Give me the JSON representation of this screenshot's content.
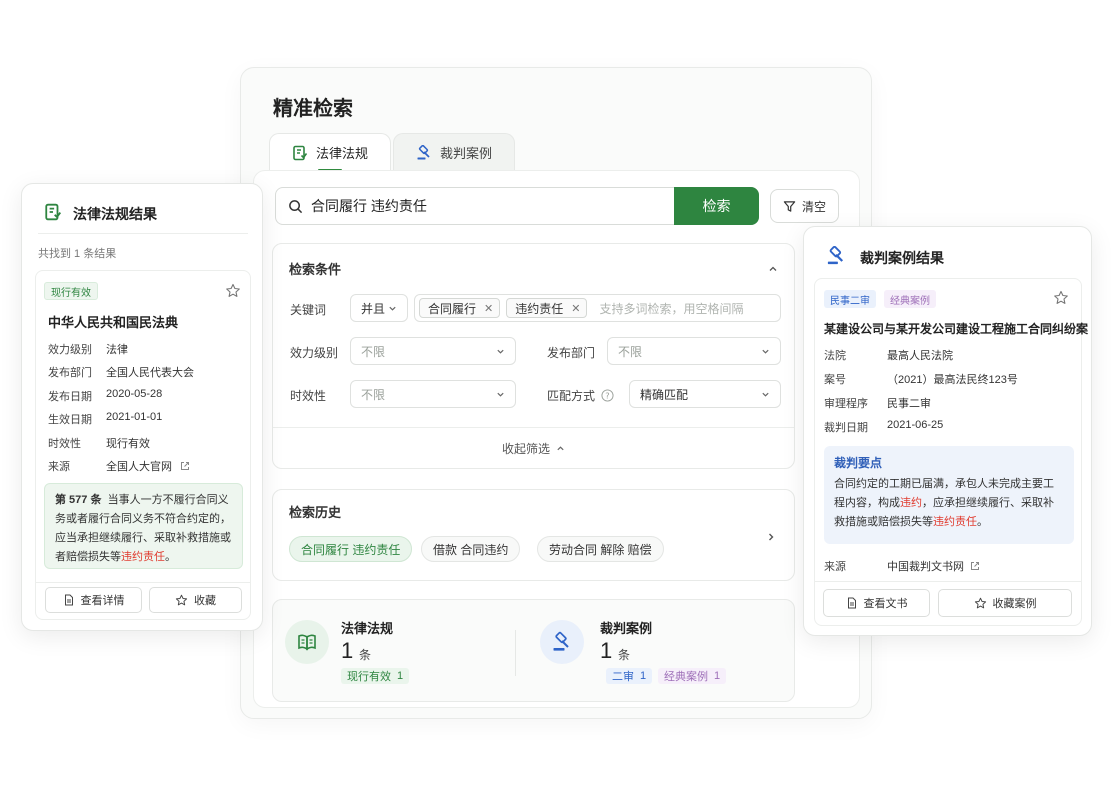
{
  "main": {
    "title": "精准检索",
    "tabs": [
      {
        "label": "法律法规",
        "icon": "law-book-icon",
        "active": true
      },
      {
        "label": "裁判案例",
        "icon": "gavel-icon",
        "active": false
      }
    ],
    "search": {
      "value": "合同履行 违约责任",
      "button": "检索",
      "clear": "清空"
    },
    "conditions": {
      "title": "检索条件",
      "keyword_label": "关键词",
      "logic": "并且",
      "keywords": [
        "合同履行",
        "违约责任"
      ],
      "keyword_placeholder": "支持多词检索，用空格间隔",
      "level_label": "效力级别",
      "level_value": "不限",
      "dept_label": "发布部门",
      "dept_value": "不限",
      "validity_label": "时效性",
      "validity_value": "不限",
      "match_label": "匹配方式",
      "match_value": "精确匹配",
      "collapse": "收起筛选"
    },
    "history": {
      "title": "检索历史",
      "items": [
        "合同履行 违约责任",
        "借款 合同违约",
        "劳动合同 解除 赔偿"
      ]
    },
    "summary": {
      "laws": {
        "name": "法律法规",
        "count": "1",
        "unit": "条",
        "badge_label": "现行有效",
        "badge_count": "1"
      },
      "cases": {
        "name": "裁判案例",
        "count": "1",
        "unit": "条",
        "badges": [
          {
            "label": "二审",
            "count": "1"
          },
          {
            "label": "经典案例",
            "count": "1"
          }
        ]
      }
    }
  },
  "law_card": {
    "title": "法律法规结果",
    "found": "共找到 1 条结果",
    "status": "现行有效",
    "name": "中华人民共和国民法典",
    "fields": [
      {
        "k": "效力级别",
        "v": "法律"
      },
      {
        "k": "发布部门",
        "v": "全国人民代表大会"
      },
      {
        "k": "发布日期",
        "v": "2020-05-28"
      },
      {
        "k": "生效日期",
        "v": "2021-01-01"
      },
      {
        "k": "时效性",
        "v": "现行有效"
      },
      {
        "k": "来源",
        "v": "全国人大官网"
      }
    ],
    "article_no": "第 577 条",
    "article_text": "当事人一方不履行合同义务或者履行合同义务不符合约定的，应当承担继续履行、采取补救措施或者赔偿损失等",
    "article_highlight": "违约责任",
    "article_end": "。",
    "btn_detail": "查看详情",
    "btn_fav": "收藏"
  },
  "case_card": {
    "title": "裁判案例结果",
    "tags": [
      "民事二审",
      "经典案例"
    ],
    "name": "某建设公司与某开发公司建设工程施工合同纠纷案",
    "fields": [
      {
        "k": "法院",
        "v": "最高人民法院"
      },
      {
        "k": "案号",
        "v": "（2021）最高法民终123号"
      },
      {
        "k": "审理程序",
        "v": "民事二审"
      },
      {
        "k": "裁判日期",
        "v": "2021-06-25"
      }
    ],
    "point_title": "裁判要点",
    "point_p1": "合同约定的工期已届满，承包人未完成主要工程内容，构成",
    "point_h1": "违约",
    "point_p2": "，应承担继续履行、采取补救措施或赔偿损失等",
    "point_h2": "违约责任",
    "point_p3": "。",
    "source_k": "来源",
    "source_v": "中国裁判文书网",
    "btn_doc": "查看文书",
    "btn_fav": "收藏案例"
  },
  "colors": {
    "primary_green": "#2e8540",
    "highlight_red": "#e03b2f",
    "case_blue": "#2f64c8"
  }
}
